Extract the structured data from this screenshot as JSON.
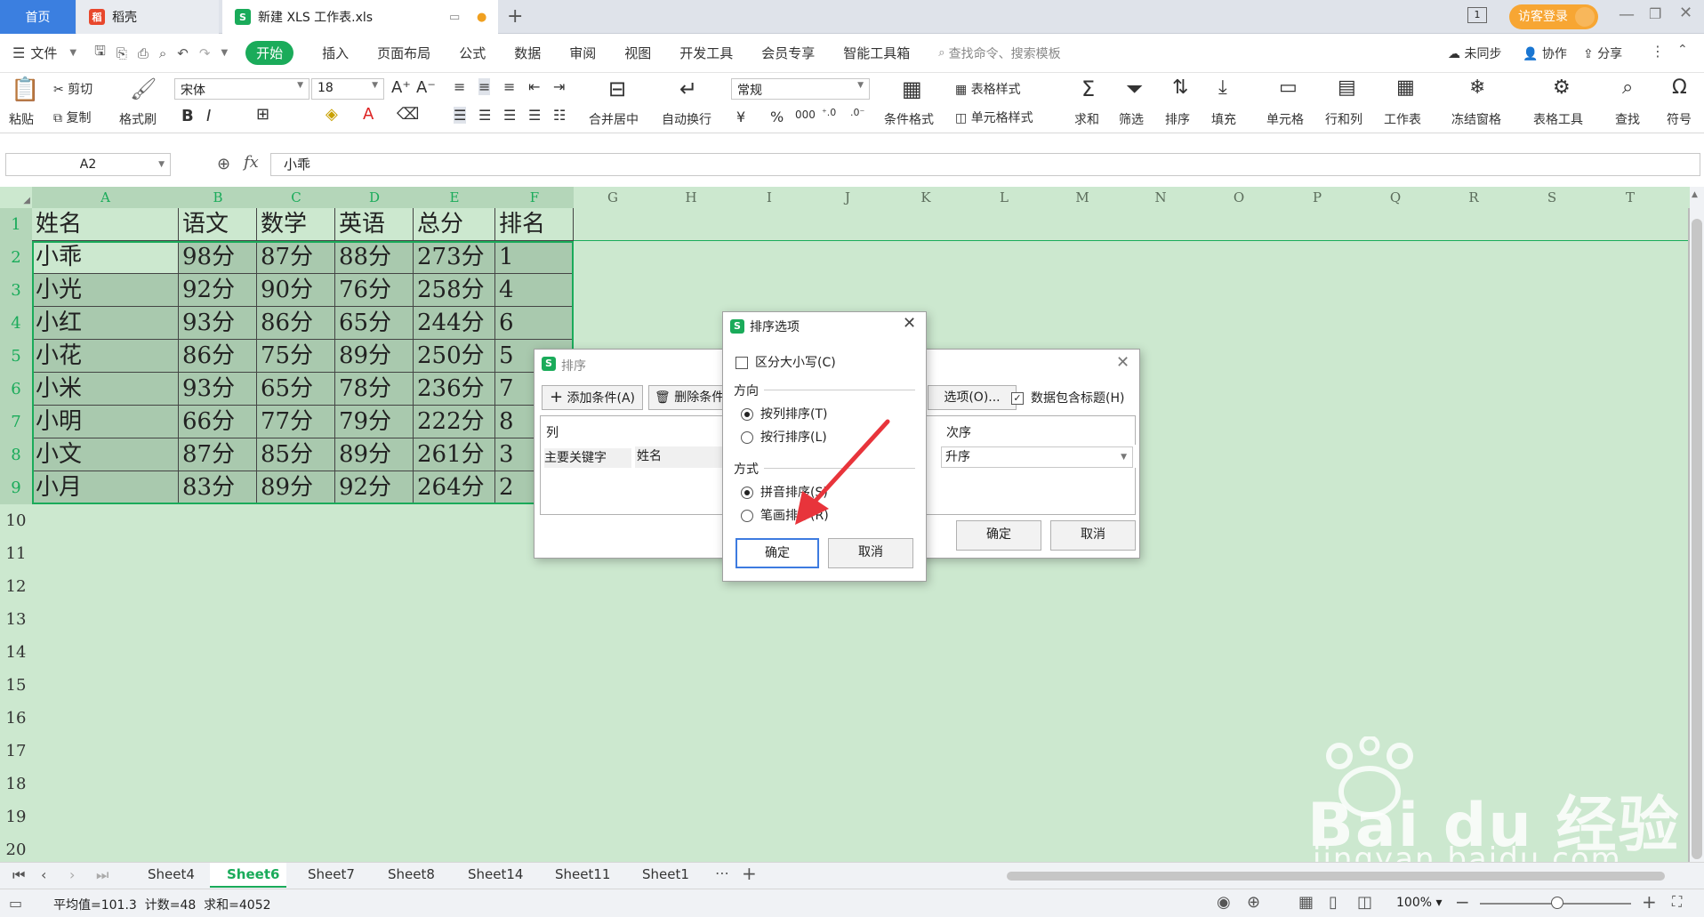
{
  "titlebar": {
    "tab_home": "首页",
    "tab_doc": "稻壳",
    "tab_file": "新建 XLS 工作表.xls",
    "login": "访客登录",
    "page_indicator": "1"
  },
  "menu": {
    "file": "文件",
    "items": [
      "开始",
      "插入",
      "页面布局",
      "公式",
      "数据",
      "审阅",
      "视图",
      "开发工具",
      "会员专享",
      "智能工具箱"
    ],
    "search_placeholder": "查找命令、搜索模板",
    "sync": "未同步",
    "collab": "协作",
    "share": "分享"
  },
  "ribbon": {
    "paste": "粘贴",
    "cut": "剪切",
    "copy": "复制",
    "format_painter": "格式刷",
    "font_name": "宋体",
    "font_size": "18",
    "merge_center": "合并居中",
    "wrap": "自动换行",
    "number_format": "常规",
    "currency": "¥",
    "percent": "%",
    "thousands": "000",
    "cond_format": "条件格式",
    "table_style": "表格样式",
    "cell_style": "单元格样式",
    "sum": "求和",
    "filter": "筛选",
    "sort": "排序",
    "fill": "填充",
    "cell": "单元格",
    "row_col": "行和列",
    "worksheet": "工作表",
    "freeze": "冻结窗格",
    "table_tools": "表格工具",
    "find": "查找",
    "symbol": "符号"
  },
  "formula_bar": {
    "cell_ref": "A2",
    "fx": "fx",
    "value": "小乖"
  },
  "columns": [
    "A",
    "B",
    "C",
    "D",
    "E",
    "F",
    "G",
    "H",
    "I",
    "J",
    "K",
    "L",
    "M",
    "N",
    "O",
    "P",
    "Q",
    "R",
    "S",
    "T"
  ],
  "rows": [
    "1",
    "2",
    "3",
    "4",
    "5",
    "6",
    "7",
    "8",
    "9",
    "10",
    "11",
    "12",
    "13",
    "14",
    "15",
    "16",
    "17",
    "18",
    "19",
    "20"
  ],
  "table": {
    "header": [
      "姓名",
      "语文",
      "数学",
      "英语",
      "总分",
      "排名"
    ],
    "data": [
      [
        "小乖",
        "98分",
        "87分",
        "88分",
        "273分",
        "1"
      ],
      [
        "小光",
        "92分",
        "90分",
        "76分",
        "258分",
        "4"
      ],
      [
        "小红",
        "93分",
        "86分",
        "65分",
        "244分",
        "6"
      ],
      [
        "小花",
        "86分",
        "75分",
        "89分",
        "250分",
        "5"
      ],
      [
        "小米",
        "93分",
        "65分",
        "78分",
        "236分",
        "7"
      ],
      [
        "小明",
        "66分",
        "77分",
        "79分",
        "222分",
        "8"
      ],
      [
        "小文",
        "87分",
        "85分",
        "89分",
        "261分",
        "3"
      ],
      [
        "小月",
        "83分",
        "89分",
        "92分",
        "264分",
        "2"
      ]
    ]
  },
  "sort_dialog": {
    "title": "排序",
    "add_condition": "添加条件(A)",
    "delete_condition": "删除条件",
    "options": "选项(O)...",
    "has_header": "数据包含标题(H)",
    "col_header": "列",
    "order_header": "次序",
    "primary_key": "主要关键字",
    "key_value": "姓名",
    "order_value": "升序",
    "ok": "确定",
    "cancel": "取消"
  },
  "options_dialog": {
    "title": "排序选项",
    "case_sensitive": "区分大小写(C)",
    "direction_label": "方向",
    "by_column": "按列排序(T)",
    "by_row": "按行排序(L)",
    "method_label": "方式",
    "pinyin": "拼音排序(S)",
    "stroke": "笔画排序(R)",
    "ok": "确定",
    "cancel": "取消"
  },
  "sheets": [
    "Sheet4",
    "Sheet6",
    "Sheet7",
    "Sheet8",
    "Sheet14",
    "Sheet11",
    "Sheet1"
  ],
  "active_sheet": "Sheet6",
  "status": {
    "summary": "平均值=101.3  计数=48  求和=4052",
    "zoom": "100%"
  },
  "watermark": {
    "brand": "Bai du 经验",
    "url": "jingyan.baidu.com"
  },
  "colors": {
    "accent": "#1aab5a",
    "grid_bg": "#cce8cf",
    "selected_cells": "#a9c9ae",
    "arrow": "#e8343b"
  }
}
